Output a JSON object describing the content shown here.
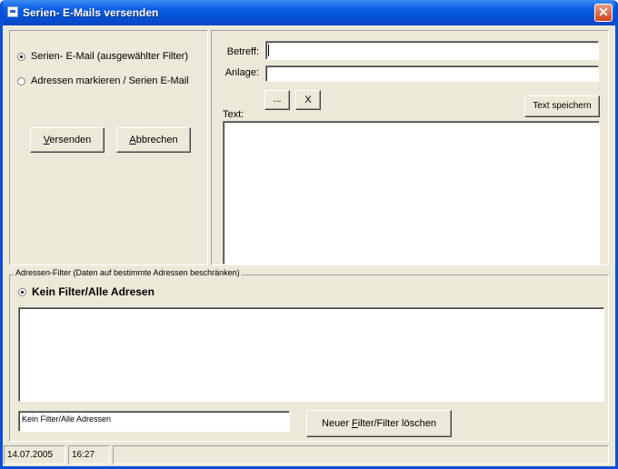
{
  "window": {
    "title": "Serien- E-Mails versenden",
    "close_glyph": "✕"
  },
  "left": {
    "radio1_label": "Serien- E-Mail (ausgewählter Filter)",
    "radio2_label": "Adressen markieren / Serien E-Mail",
    "send_prefix": "V",
    "send_rest": "ersenden",
    "cancel_prefix": "A",
    "cancel_rest": "bbrechen"
  },
  "right": {
    "subject_label": "Betreff:",
    "subject_value": "",
    "attachment_label": "Anlage:",
    "attachment_value": "",
    "browse_label": "...",
    "clear_label": "X",
    "save_text_label": "Text speichern",
    "text_label": "Text:",
    "text_value": ""
  },
  "filter": {
    "legend": "Adressen-Filter (Daten auf bestimmte Adressen beschränken)",
    "radio_label": "Kein Filter/Alle Adresen",
    "current_filter": "Kein Filter/Alle Adressen",
    "new_filter_prefix": "Neuer ",
    "new_filter_u": "F",
    "new_filter_rest": "ilter/Filter löschen"
  },
  "status": {
    "date": "14.07.2005",
    "time": "16:27",
    "extra": ""
  }
}
